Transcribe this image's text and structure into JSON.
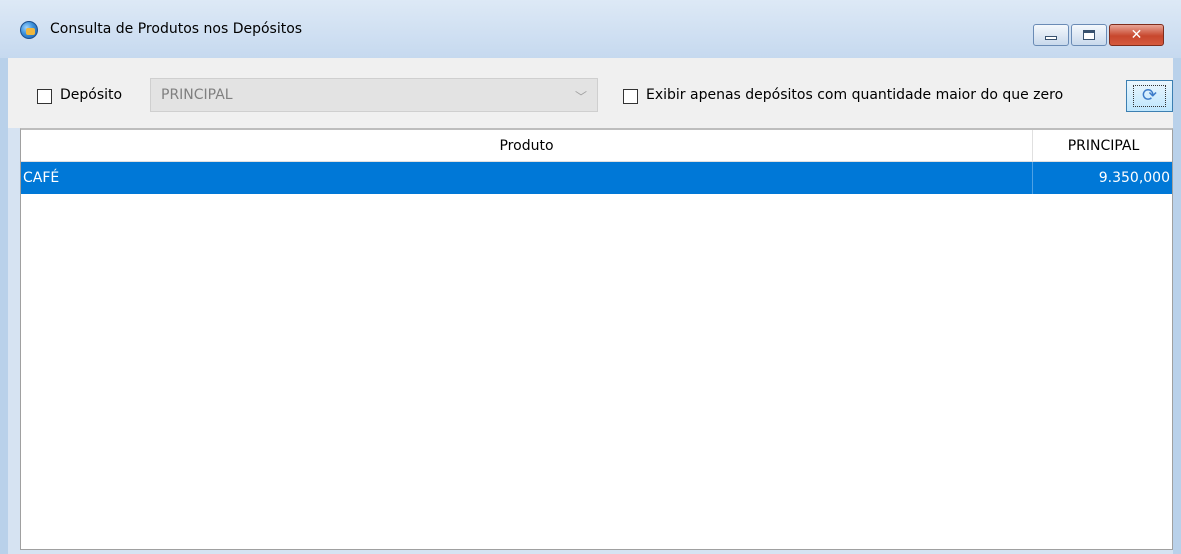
{
  "window": {
    "title": "Consulta de Produtos nos Depósitos",
    "close_glyph": "✕"
  },
  "toolbar": {
    "deposito_label": "Depósito",
    "deposito_checked": false,
    "deposito_value": "PRINCIPAL",
    "exibir_label": "Exibir apenas depósitos com quantidade maior do que zero",
    "exibir_checked": false,
    "refresh_icon": "refresh-icon"
  },
  "grid": {
    "columns": [
      "Produto",
      "PRINCIPAL"
    ],
    "rows": [
      {
        "produto": "CAFÉ",
        "principal": "9.350,000",
        "selected": true
      }
    ]
  },
  "colors": {
    "selection": "#0078d7",
    "titlebar": "#c6d9ef"
  }
}
